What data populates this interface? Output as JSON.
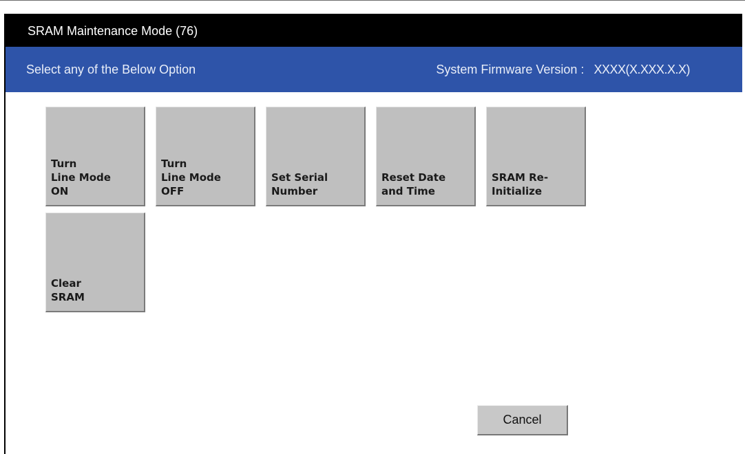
{
  "window": {
    "title": "SRAM Maintenance Mode (76)"
  },
  "header": {
    "prompt": "Select any of the Below Option",
    "firmware_label": "System Firmware Version :",
    "firmware_value": "XXXX(X.XXX.X.X)"
  },
  "options": [
    {
      "label": "Turn\nLine Mode\nON"
    },
    {
      "label": "Turn\nLine Mode\nOFF"
    },
    {
      "label": "Set Serial\nNumber"
    },
    {
      "label": "Reset Date\nand Time"
    },
    {
      "label": "SRAM Re-\nInitialize"
    },
    {
      "label": "Clear\nSRAM"
    }
  ],
  "footer": {
    "cancel_label": "Cancel"
  },
  "colors": {
    "title_bar": "#000000",
    "header_bar": "#2e54a9",
    "tile": "#bfbfbf",
    "cancel_button": "#c8c8c8"
  }
}
